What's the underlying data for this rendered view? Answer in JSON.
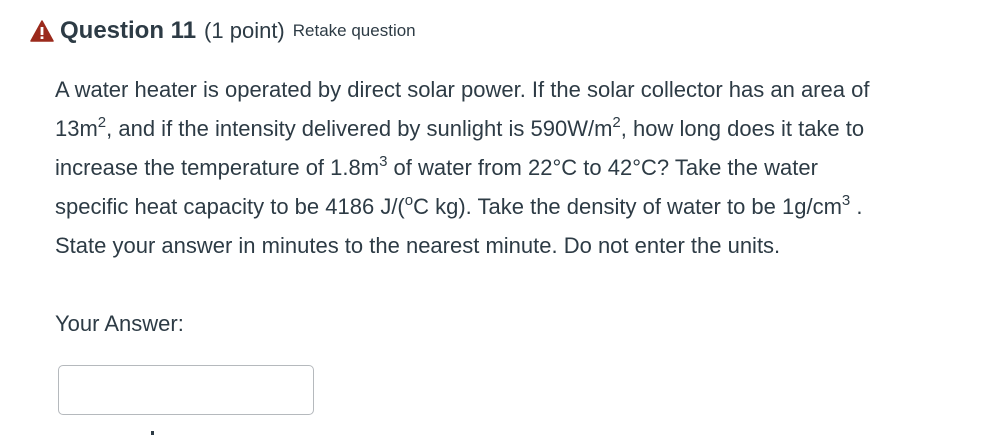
{
  "header": {
    "icon": "warning-triangle-icon",
    "icon_color": "#9b2a1c",
    "title": "Question 11",
    "points": "(1 point)",
    "retake": "Retake question"
  },
  "question": {
    "line1": "A water heater is operated by direct solar power. If the solar collector has an area of",
    "l2_a": "13m",
    "l2_sup": "2",
    "l2_b": ", and if the intensity delivered by sunlight is 590W/m",
    "l2_sup2": "2",
    "l2_c": ", how long does it take to",
    "l3_a": "increase the temperature of 1.8m",
    "l3_sup": "3",
    "l3_b": " of water from 22°C to 42°C? Take the water",
    "l4_a": "specific heat capacity to be 4186 J/(",
    "l4_sup": "o",
    "l4_b": "C kg).  Take the density of water to be 1g/cm",
    "l4_sup2": "3",
    "l4_c": " .",
    "line5": "State your answer in minutes to the nearest minute. Do not enter the units."
  },
  "answer": {
    "label": "Your Answer:",
    "value": "",
    "placeholder": ""
  }
}
